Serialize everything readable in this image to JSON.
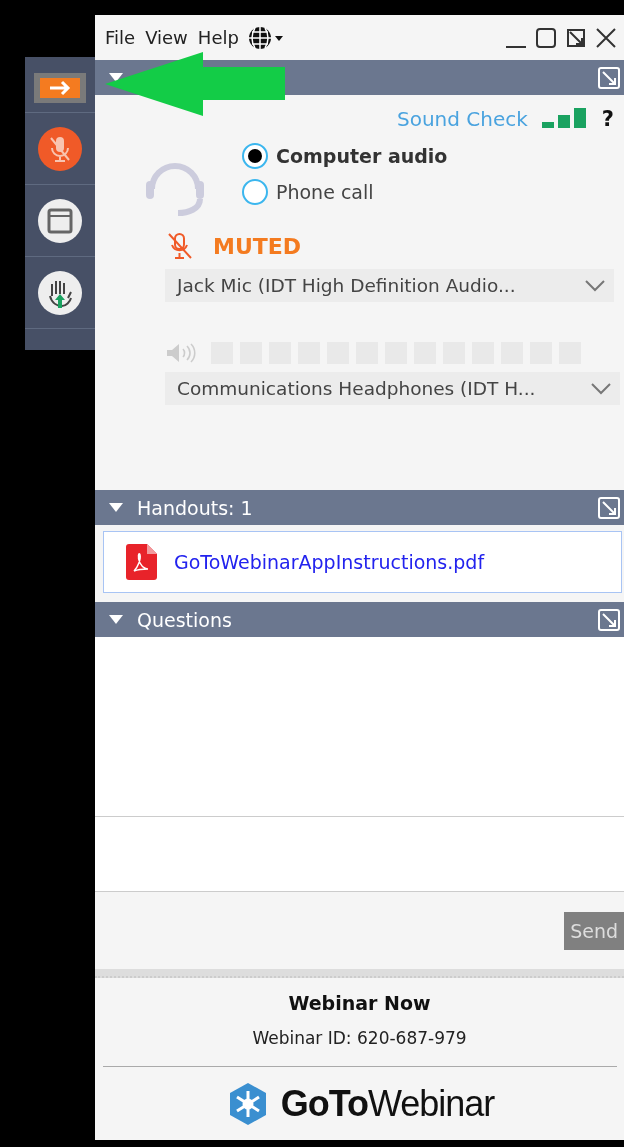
{
  "menu": [
    "File",
    "View",
    "Help"
  ],
  "audio": {
    "sound_check": "Sound Check",
    "help": "?",
    "modes": [
      {
        "label": "Computer audio",
        "selected": true
      },
      {
        "label": "Phone call",
        "selected": false
      }
    ],
    "mic_status": "MUTED",
    "microphone": "Jack Mic (IDT High Definition Audio...",
    "speaker_meter": {
      "level": 0
    },
    "speaker": "Communications  Headphones  (IDT H..."
  },
  "handouts": {
    "title": "Handouts: 1",
    "files": [
      "GoToWebinarAppInstructions.pdf"
    ]
  },
  "questions": {
    "title": "Questions",
    "send": "Send"
  },
  "footer": {
    "title": "Webinar Now",
    "webinar_id": "Webinar ID: 620-687-979",
    "logo": "**GoTo**Webinar"
  }
}
